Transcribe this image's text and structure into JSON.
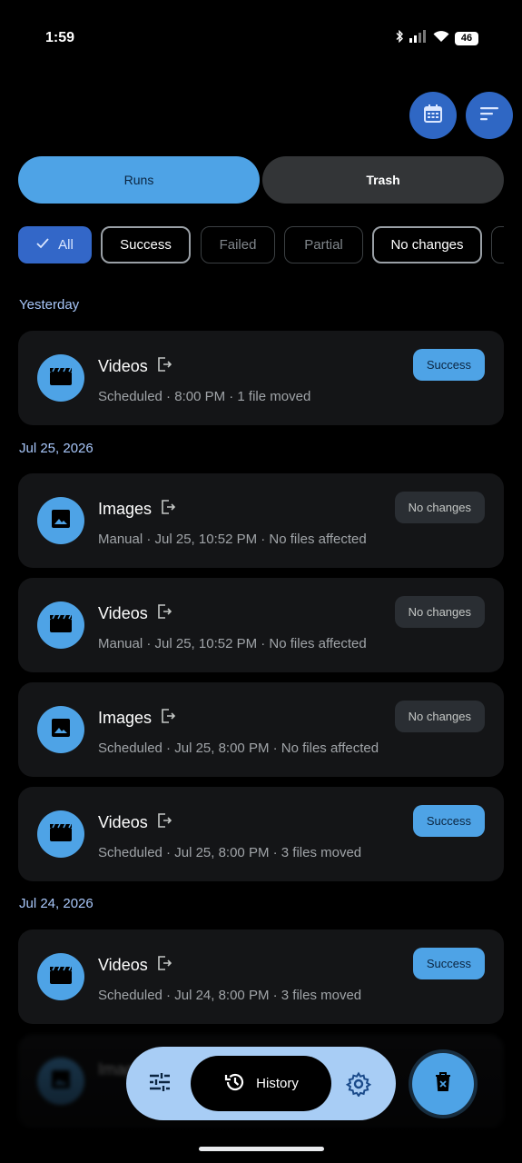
{
  "status_bar": {
    "time": "1:59",
    "battery": "46"
  },
  "tabs": {
    "runs": "Runs",
    "trash": "Trash"
  },
  "filters": [
    "All",
    "Success",
    "Failed",
    "Partial",
    "No changes"
  ],
  "sections": [
    {
      "date": "Yesterday",
      "runs": [
        {
          "name": "Videos",
          "type": "video",
          "meta": "Scheduled · 8:00 PM · 1 file moved",
          "status": "Success"
        }
      ]
    },
    {
      "date": "Jul 25, 2026",
      "runs": [
        {
          "name": "Images",
          "type": "image",
          "meta": "Manual · Jul 25, 10:52 PM · No files affected",
          "status": "No changes"
        },
        {
          "name": "Videos",
          "type": "video",
          "meta": "Manual · Jul 25, 10:52 PM · No files affected",
          "status": "No changes"
        },
        {
          "name": "Images",
          "type": "image",
          "meta": "Scheduled · Jul 25, 8:00 PM · No files affected",
          "status": "No changes"
        },
        {
          "name": "Videos",
          "type": "video",
          "meta": "Scheduled · Jul 25, 8:00 PM · 3 files moved",
          "status": "Success"
        }
      ]
    },
    {
      "date": "Jul 24, 2026",
      "runs": [
        {
          "name": "Videos",
          "type": "video",
          "meta": "Scheduled · Jul 24, 8:00 PM · 3 files moved",
          "status": "Success"
        },
        {
          "name": "Images",
          "type": "image",
          "meta": "",
          "status": ""
        }
      ]
    }
  ],
  "bottom_nav": {
    "active_label": "History"
  },
  "colors": {
    "accent": "#4ea3e6",
    "accent_dark": "#3367c8",
    "card": "#141517",
    "nav": "#a8cdf5"
  },
  "icons": [
    "calendar-icon",
    "sort-icon",
    "check-icon",
    "video-icon",
    "image-icon",
    "export-icon",
    "tune-icon",
    "history-icon",
    "settings-icon",
    "delete-icon"
  ]
}
